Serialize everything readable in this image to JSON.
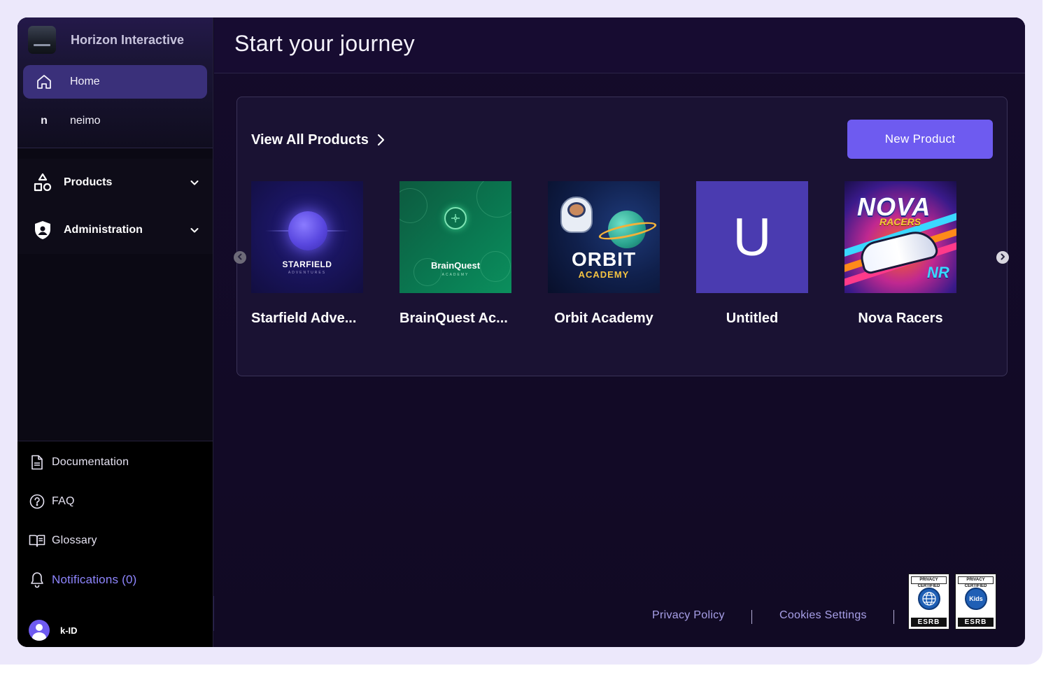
{
  "sidebar": {
    "brand_name": "Horizon Interactive",
    "nav": [
      {
        "label": "Home",
        "icon": "home-icon",
        "active": true
      },
      {
        "label": "neimo",
        "letter": "n"
      }
    ],
    "sections": [
      {
        "label": "Products",
        "icon": "shapes-icon"
      },
      {
        "label": "Administration",
        "icon": "shield-user-icon"
      }
    ],
    "links": [
      {
        "label": "Documentation",
        "icon": "document-icon"
      },
      {
        "label": "FAQ",
        "icon": "question-circle-icon"
      },
      {
        "label": "Glossary",
        "icon": "book-icon"
      },
      {
        "label": "Notifications (0)",
        "icon": "bell-icon"
      }
    ],
    "user": {
      "name": "k-ID"
    }
  },
  "main": {
    "title": "Start your journey",
    "card": {
      "view_all_label": "View All Products",
      "new_product_label": "New Product",
      "products": [
        {
          "name": "Starfield Adve...",
          "thumb_title": "STARFIELD",
          "thumb_sub": "ADVENTURES"
        },
        {
          "name": "BrainQuest Ac...",
          "thumb_title": "BrainQuest",
          "thumb_sub": "ACADEMY"
        },
        {
          "name": "Orbit Academy",
          "thumb_title": "ORBIT",
          "thumb_sub": "ACADEMY"
        },
        {
          "name": "Untitled",
          "thumb_letter": "U"
        },
        {
          "name": "Nova Racers",
          "thumb_title": "NOVA",
          "thumb_sub": "RACERS",
          "thumb_badge": "NR"
        }
      ]
    },
    "footer": {
      "privacy_label": "Privacy Policy",
      "cookies_label": "Cookies Settings",
      "badges": [
        {
          "top": "PRIVACY CERTIFIED",
          "seal": "",
          "bottom": "ESRB"
        },
        {
          "top": "PRIVACY CERTIFIED",
          "seal": "Kids",
          "bottom": "ESRB"
        }
      ]
    }
  },
  "colors": {
    "accent": "#6e5bf0",
    "active_nav": "#3a307a",
    "notification_text": "#8f86ff"
  }
}
